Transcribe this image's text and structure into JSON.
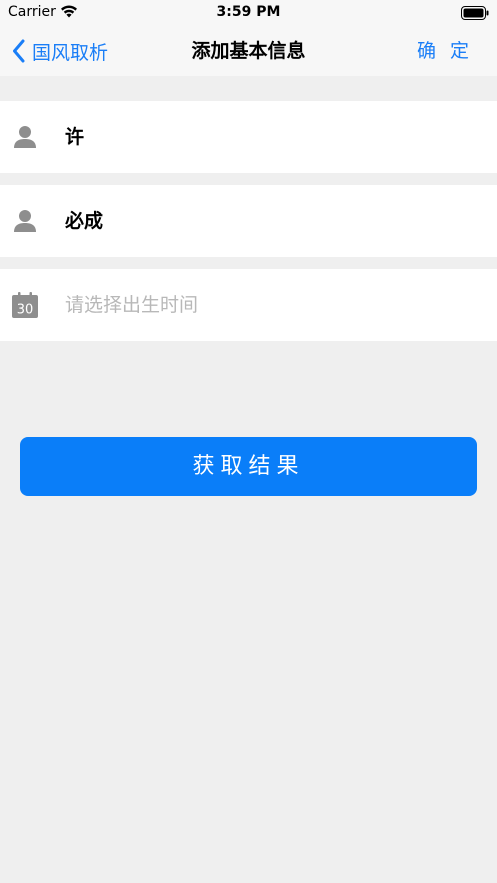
{
  "status_bar": {
    "carrier": "Carrier",
    "time": "3:59 PM",
    "wifi_icon": "wifi-icon",
    "battery_icon": "battery-icon"
  },
  "nav": {
    "back_label": "国风取析",
    "title": "添加基本信息",
    "confirm_label": "确 定",
    "accent_color": "#1a7ef7"
  },
  "form": {
    "surname": {
      "value": "许",
      "icon": "person-icon"
    },
    "given_name": {
      "value": "必成",
      "icon": "person-icon"
    },
    "birth_time": {
      "placeholder": "请选择出生时间",
      "icon": "calendar-icon",
      "calendar_day": "30"
    }
  },
  "actions": {
    "get_result_label": "获取结果",
    "button_color": "#0a7ef9"
  }
}
